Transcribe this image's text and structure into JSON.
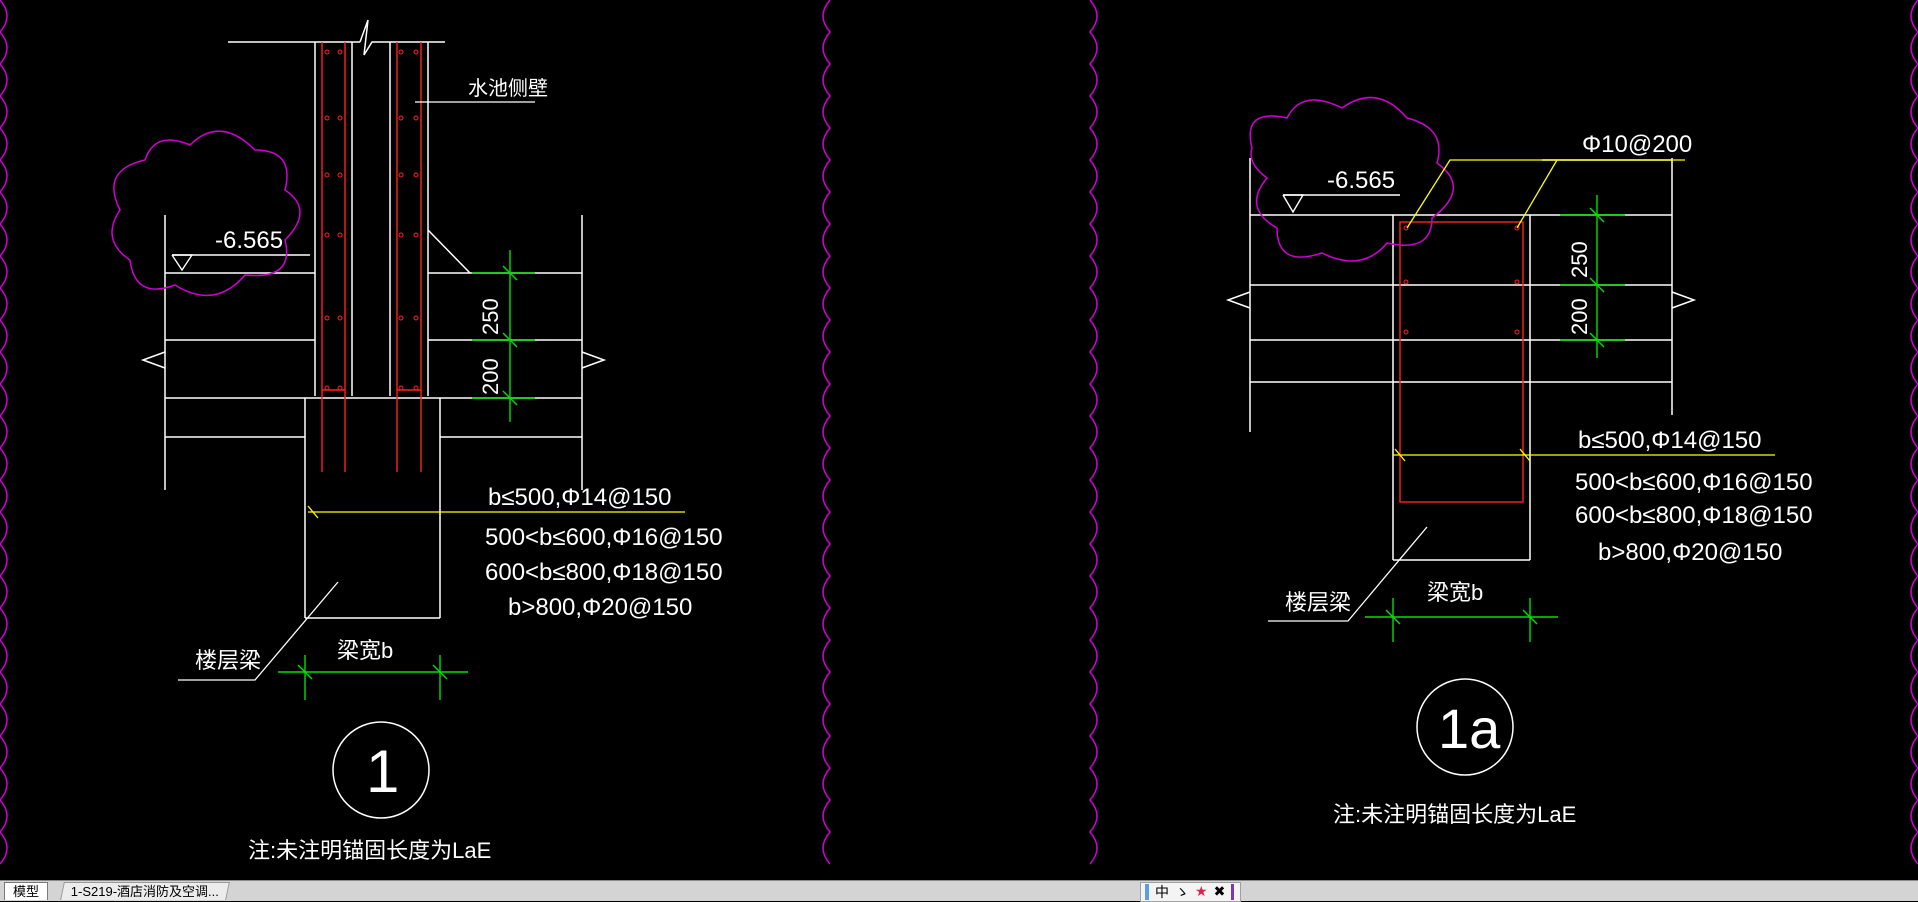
{
  "drawing": {
    "left_detail": {
      "elevation": "-6.565",
      "wall_label": "水池侧壁",
      "dim_upper": "250",
      "dim_lower": "200",
      "rebar_rules": [
        "b≤500,Φ14@150",
        "500<b≤600,Φ16@150",
        "600<b≤800,Φ18@150",
        "b>800,Φ20@150"
      ],
      "beam_label": "楼层梁",
      "beam_width_label": "梁宽b",
      "detail_number": "1",
      "note": "注:未注明锚固长度为LaE"
    },
    "right_detail": {
      "elevation": "-6.565",
      "stirrup_label": "Φ10@200",
      "dim_upper": "250",
      "dim_lower": "200",
      "rebar_rules": [
        "b≤500,Φ14@150",
        "500<b≤600,Φ16@150",
        "600<b≤800,Φ18@150",
        "b>800,Φ20@150"
      ],
      "beam_label": "楼层梁",
      "beam_width_label": "梁宽b",
      "detail_number": "1a",
      "note": "注:未注明锚固长度为LaE"
    },
    "colors": {
      "background": "#000000",
      "linework": "#ffffff",
      "rebar": "#ff2020",
      "dimension": "#00e000",
      "leader": "#ffff00",
      "revision_cloud": "#d000d0"
    }
  },
  "tabs": {
    "model": "模型",
    "layout": "1-S219-酒店消防及空调..."
  },
  "ime": {
    "lang": "中",
    "punct": "ゝ",
    "star": "★",
    "settings": "✖"
  }
}
